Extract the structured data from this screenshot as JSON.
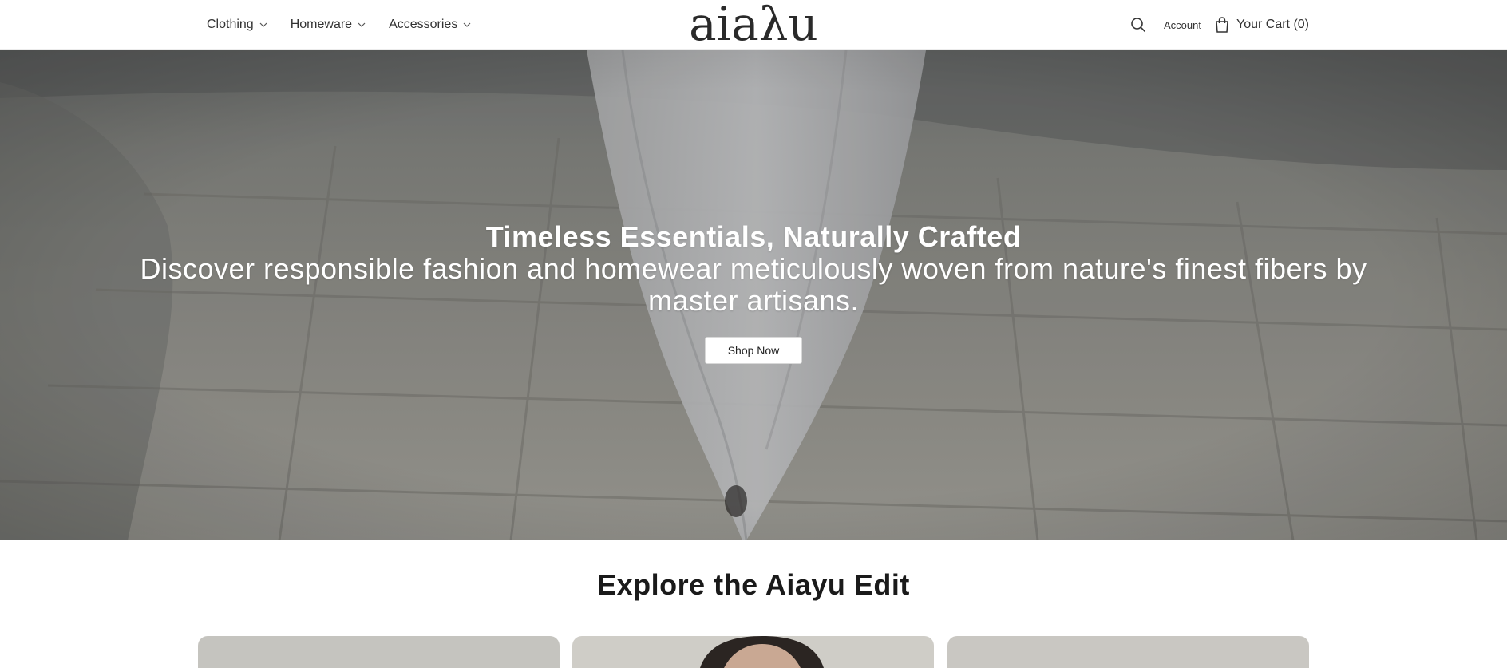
{
  "brand": {
    "logo_text": "aiaλu"
  },
  "nav": {
    "items": [
      {
        "label": "Clothing"
      },
      {
        "label": "Homeware"
      },
      {
        "label": "Accessories"
      }
    ]
  },
  "header_right": {
    "search_icon": "search-icon",
    "account_label": "Account",
    "cart_label": "Your Cart (0)",
    "cart_icon": "shopping-bag-icon"
  },
  "hero": {
    "title": "Timeless Essentials, Naturally Crafted",
    "subtitle": "Discover responsible fashion and homewear meticulously woven from nature's finest fibers by master artisans.",
    "cta_label": "Shop Now"
  },
  "explore": {
    "title": "Explore the Aiayu Edit"
  },
  "colors": {
    "text": "#333333",
    "hero_text": "#ffffff",
    "button_bg": "#ffffff"
  }
}
